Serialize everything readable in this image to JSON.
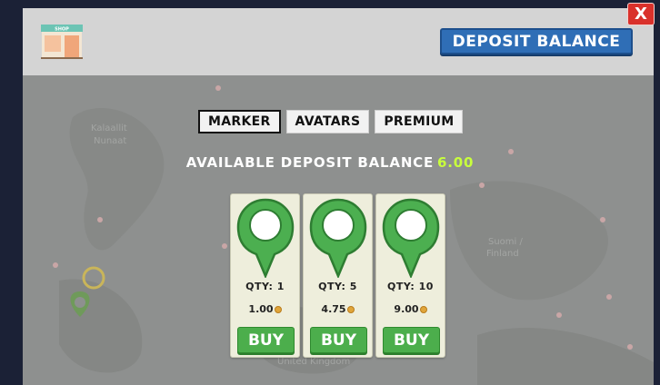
{
  "header": {
    "deposit_button_label": "DEPOSIT BALANCE",
    "close_label": "X",
    "shop_sign": "SHOP"
  },
  "tabs": [
    {
      "label": "MARKER",
      "active": true
    },
    {
      "label": "AVATARS",
      "active": false
    },
    {
      "label": "PREMIUM",
      "active": false
    }
  ],
  "balance": {
    "label": "AVAILABLE DEPOSIT BALANCE",
    "amount": "6.00"
  },
  "products": [
    {
      "qty": "QTY: 1",
      "price": "1.00",
      "buy_label": "BUY"
    },
    {
      "qty": "QTY: 5",
      "price": "4.75",
      "buy_label": "BUY"
    },
    {
      "qty": "QTY: 10",
      "price": "9.00",
      "buy_label": "BUY"
    }
  ],
  "map_labels": {
    "label_1": "Kalaallit",
    "label_2": "Nunaat",
    "label_3": "Suomi /",
    "label_4": "Finland",
    "label_5": "United Kingdom"
  },
  "colors": {
    "accent_blue": "#2f6eb6",
    "buy_green": "#4cae4c",
    "close_red": "#d9312b",
    "balance_highlight": "#c8ff3c",
    "marker_green": "#4caf50"
  },
  "icons": {
    "shop": "shop-icon",
    "marker": "map-marker-icon",
    "coin": "coin-icon"
  }
}
